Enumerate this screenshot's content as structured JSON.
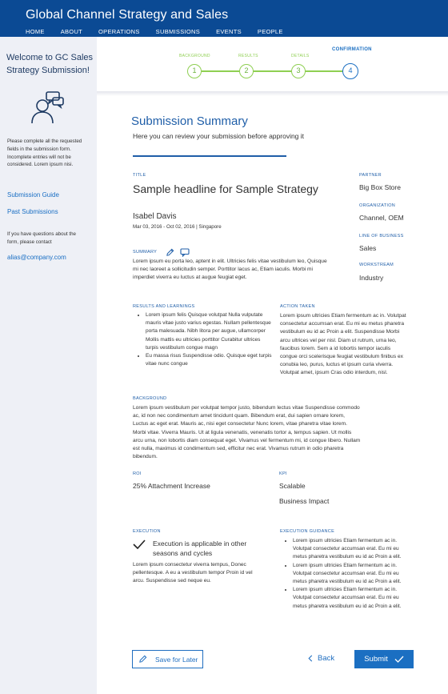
{
  "header": {
    "title": "Global Channel Strategy and Sales",
    "nav": [
      "HOME",
      "ABOUT",
      "OPERATIONS",
      "SUBMISSIONS",
      "EVENTS",
      "PEOPLE"
    ],
    "active_nav": "SUBMISSIONS"
  },
  "sidebar": {
    "welcome": "Welcome to GC Sales Strategy Submission!",
    "note": "Please complete all the requested fields in the submission form. Incomplete entries will not be considered. Lorem ipsum nisi.",
    "links": [
      "Submission Guide",
      "Past Submissions"
    ],
    "contact_note": "If you have questions about the form, please contact",
    "contact_email": "alias@company.com"
  },
  "stepper": {
    "steps": [
      {
        "label": "BACKGROUND",
        "number": "1"
      },
      {
        "label": "RESULTS",
        "number": "2"
      },
      {
        "label": "DETAILS",
        "number": "3"
      },
      {
        "label": "CONFIRMATION",
        "number": "4"
      }
    ]
  },
  "summary": {
    "title": "Submission Summary",
    "subtitle": "Here you can review your submission before approving it"
  },
  "details": {
    "title_label": "TITLE",
    "title_value": "Sample headline for Sample Strategy",
    "author": "Isabel Davis",
    "meta": "Mar 03, 2016 - Oct 02, 2016 | Singapore",
    "summary_label": "SUMMARY",
    "summary_text": "Lorem ipsum eu porta leo, aptent in elit. Ultricies felis vitae vestibulum leo, Quisque mi nec laoreet a sollicitudin semper. Porttitor lacus ac, Etiam iaculis. Morbi mi imperdiet viverra eu luctus at augue feugiat eget.",
    "partner_label": "PARTNER",
    "partner_value": "Big Box Store",
    "org_label": "ORGANIZATION",
    "org_value": "Channel, OEM",
    "lob_label": "LINE OF BUSINESS",
    "lob_value": "Sales",
    "workstream_label": "WORKSTREAM",
    "workstream_value": "Industry"
  },
  "results": {
    "label": "RESULTS AND LEARNINGS",
    "bullets": [
      "Lorem ipsum felis Quisque volutpat  Nulla vulputate mauris vitae justo varius egestas. Nullam pellentesque porta malesuada. Nibh litora per augue, ullamcorper Mollis mattis eu ultricies porttitor Curabitur ultrices turpis vestibulum congue magn",
      "Eu massa risus Suspendisse odio. Quisque eget turpis vitae nunc congue"
    ]
  },
  "action": {
    "label": "ACTION TAKEN",
    "text": "Lorem ipsum ultricies Etiam fermentum ac in. Volutpat consectetur accumsan erat. Eu mi eu metus pharetra vestibulum eu id ac Proin a elit. Suspendisse Morbi arcu ultrices vel per nisl. Diam ut rutrum, urna leo, faucibus lorem. Sem a id lobortis tempor iaculis congue orci scelerisque feugiat vestibulum finibus ex conubia leo, purus, luctus et ipsum curia viverra. Volutpat amet, ipsum Cras odio interdum, nisl."
  },
  "background": {
    "label": "BACKGROUND",
    "text": "Lorem ipsum vestibulum per volutpat tempor justo, bibendum lectus vitae Suspendisse commodo ac, id non nec condimentum amet tincidunt quam. Bibendum erat, dui sapien ornare lorem, Luctus ac eget erat. Mauris ac, nisi eget consectetur Nunc lorem, vitae pharetra vitae lorem. Morbi vitae. Viverra Mauris. Ut at ligula venenatis, venenatis tortor a, tempus sapien. Ut mollis arcu urna, non lobortis diam consequat eget. Vivamus vel fermentum mi, id congue libero. Nullam est nulla, maximus id condimentum sed, efficitur nec erat. Vivamus rutrum in odio pharetra bibendum."
  },
  "roi": {
    "label": "ROI",
    "value": "25% Attachment Increase"
  },
  "kpi": {
    "label": "KPI",
    "values": [
      "Scalable",
      "Business Impact"
    ]
  },
  "execution": {
    "label": "EXECUTION",
    "check_text": "Execution is applicable in other seasons and cycles",
    "text": "Lorem ipsum consectetur viverra tempus, Donec pellentesque. A eu a vestibulum tempor Proin id vel arcu. Suspendisse sed neque eu."
  },
  "guidance": {
    "label": "EXECUTION GUIDANCE",
    "bullets": [
      "Lorem ipsum ultricies Etiam fermentum ac in. Volutpat consectetur accumsan erat. Eu mi eu metus pharetra vestibulum eu id ac Proin a elit.",
      "Lorem ipsum ultricies Etiam fermentum ac in. Volutpat consectetur accumsan erat. Eu mi eu metus pharetra vestibulum eu id ac Proin a elit.",
      "Lorem ipsum ultricies Etiam fermentum ac in. Volutpat consectetur accumsan erat. Eu mi eu metus pharetra vestibulum eu id ac Proin a elit."
    ]
  },
  "actions": {
    "save": "Save for Later",
    "back": "Back",
    "submit": "Submit"
  },
  "colors": {
    "header": "#0b4a94",
    "accent": "#1b6fc2",
    "complete_step": "#8fcf52",
    "sidebar_bg": "#eef0f6"
  }
}
